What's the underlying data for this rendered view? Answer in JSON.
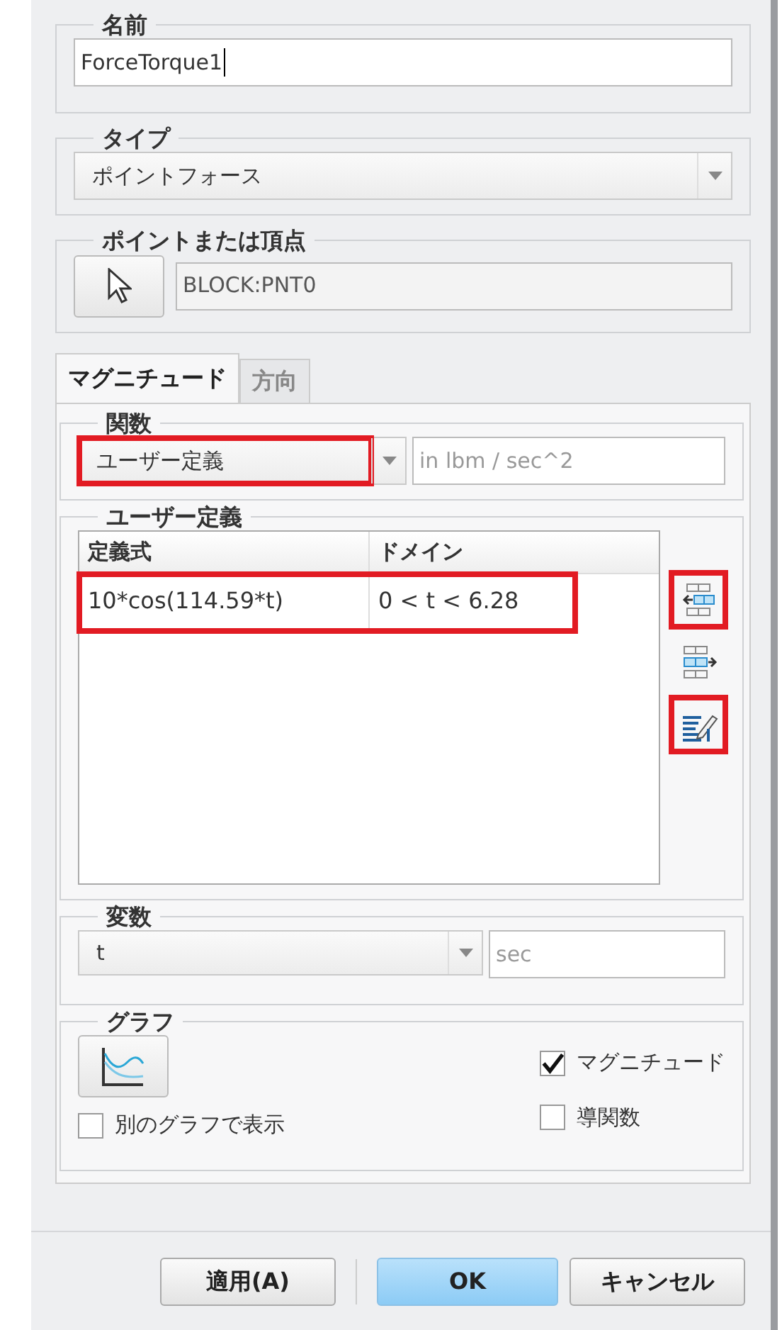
{
  "name": {
    "label": "名前",
    "value": "ForceTorque1"
  },
  "type": {
    "label": "タイプ",
    "value": "ポイントフォース"
  },
  "point": {
    "label": "ポイントまたは頂点",
    "value": "BLOCK:PNT0"
  },
  "tabs": [
    {
      "label": "マグニチュード",
      "selected": true
    },
    {
      "label": "方向",
      "selected": false
    }
  ],
  "function": {
    "label": "関数",
    "value": "ユーザー定義",
    "highlighted": true,
    "units": "in lbm / sec^2"
  },
  "user_defined": {
    "label": "ユーザー定義",
    "columns": [
      "定義式",
      "ドメイン"
    ],
    "rows": [
      {
        "cells": [
          "10*cos(114.59*t)",
          "0 < t < 6.28"
        ],
        "highlighted": true
      }
    ],
    "tools": [
      {
        "kind": "insert",
        "highlighted": true
      },
      {
        "kind": "append",
        "highlighted": false
      },
      {
        "kind": "edit",
        "highlighted": true
      }
    ]
  },
  "variable": {
    "label": "変数",
    "value": "t",
    "units": "sec"
  },
  "graph": {
    "label": "グラフ",
    "options": [
      {
        "label": "別のグラフで表示",
        "checked": false
      },
      {
        "label": "マグニチュード",
        "checked": true
      },
      {
        "label": "導関数",
        "checked": false
      }
    ]
  },
  "buttons": [
    {
      "label": "適用(A)",
      "kind": "default"
    },
    {
      "label": "OK",
      "kind": "primary"
    },
    {
      "label": "キャンセル",
      "kind": "default"
    }
  ]
}
